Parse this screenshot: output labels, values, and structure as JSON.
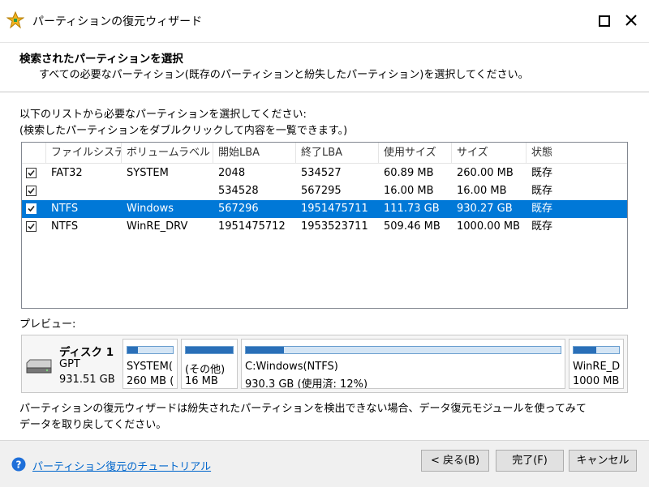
{
  "window": {
    "title": "パーティションの復元ウィザード"
  },
  "header": {
    "title": "検索されたパーティションを選択",
    "subtitle": "すべての必要なパーティション(既存のパーティションと紛失したパーティション)を選択してください。"
  },
  "instructions": [
    "以下のリストから必要なパーティションを選択してください:",
    "(検索したパーティションをダブルクリックして内容を一覧できます。)"
  ],
  "table": {
    "columns": [
      "ファイルシステム",
      "ボリュームラベル",
      "開始LBA",
      "終了LBA",
      "使用サイズ",
      "サイズ",
      "状態"
    ],
    "rows": [
      {
        "checked": true,
        "fs": "FAT32",
        "label": "SYSTEM",
        "start": "2048",
        "end": "534527",
        "used": "60.89 MB",
        "size": "260.00 MB",
        "status": "既存",
        "selected": false
      },
      {
        "checked": true,
        "fs": "",
        "label": "",
        "start": "534528",
        "end": "567295",
        "used": "16.00 MB",
        "size": "16.00 MB",
        "status": "既存",
        "selected": false
      },
      {
        "checked": true,
        "fs": "NTFS",
        "label": "Windows",
        "start": "567296",
        "end": "1951475711",
        "used": "111.73 GB",
        "size": "930.27 GB",
        "status": "既存",
        "selected": true
      },
      {
        "checked": true,
        "fs": "NTFS",
        "label": "WinRE_DRV",
        "start": "1951475712",
        "end": "1953523711",
        "used": "509.46 MB",
        "size": "1000.00 MB",
        "status": "既存",
        "selected": false
      }
    ]
  },
  "preview": {
    "label": "プレビュー:",
    "disk": {
      "name": "ディスク 1",
      "type": "GPT",
      "size": "931.51 GB"
    },
    "partitions": [
      {
        "name": "SYSTEM(",
        "info": "260 MB (",
        "used_fraction": 0.23
      },
      {
        "name": "(その他)",
        "info": "16 MB",
        "used_fraction": 1.0
      },
      {
        "name": "C:Windows(NTFS)",
        "info": "930.3 GB (使用済: 12%)",
        "used_fraction": 0.12
      },
      {
        "name": "WinRE_D",
        "info": "1000 MB",
        "used_fraction": 0.5
      }
    ]
  },
  "footer_note": [
    "パーティションの復元ウィザードは紛失されたパーティションを検出できない場合、データ復元モジュールを使ってみて",
    "データを取り戻してください。"
  ],
  "bottom": {
    "help_link": "パーティション復元のチュートリアル",
    "back": "< 戻る(B)",
    "finish": "完了(F)",
    "cancel": "キャンセル"
  },
  "colors": {
    "selection": "#0078d7",
    "link": "#0066cc",
    "bar_fill": "#2a6fb8"
  },
  "icons": {
    "app": "wizard-app-icon",
    "help": "question-circle-icon",
    "disk": "hard-disk-icon"
  }
}
